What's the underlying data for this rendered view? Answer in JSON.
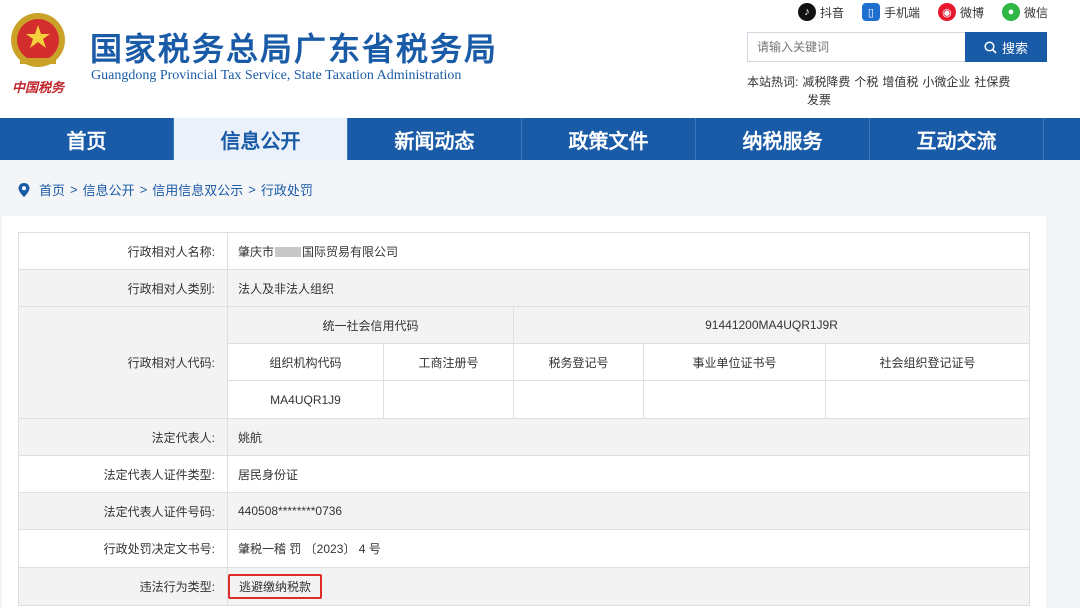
{
  "header": {
    "title_cn": "国家税务总局广东省税务局",
    "title_en": "Guangdong Provincial Tax Service, State Taxation Administration",
    "social": [
      {
        "label": "抖音",
        "icon": "douyin-icon"
      },
      {
        "label": "手机端",
        "icon": "mobile-icon"
      },
      {
        "label": "微博",
        "icon": "weibo-icon"
      },
      {
        "label": "微信",
        "icon": "wechat-icon"
      }
    ],
    "search": {
      "placeholder": "请输入关键词",
      "button_label": "搜索"
    },
    "hot": {
      "label": "本站热词:",
      "words": [
        "减税降费",
        "个税",
        "增值税",
        "小微企业",
        "社保费",
        "发票"
      ]
    }
  },
  "nav": {
    "items": [
      "首页",
      "信息公开",
      "新闻动态",
      "政策文件",
      "纳税服务",
      "互动交流"
    ],
    "active": "信息公开"
  },
  "breadcrumb": [
    "首页",
    "信息公开",
    "信用信息双公示",
    "行政处罚"
  ],
  "record": {
    "name_label": "行政相对人名称:",
    "name_prefix": "肇庆市",
    "name_suffix": "国际贸易有限公司",
    "category_label": "行政相对人类别:",
    "category_value": "法人及非法人组织",
    "code_label": "行政相对人代码:",
    "uscc_label": "统一社会信用代码",
    "uscc_value": "91441200MA4UQR1J9R",
    "code_headers": [
      "组织机构代码",
      "工商注册号",
      "税务登记号",
      "事业单位证书号",
      "社会组织登记证号"
    ],
    "code_values": [
      "MA4UQR1J9",
      "",
      "",
      "",
      ""
    ],
    "legal_rep_label": "法定代表人:",
    "legal_rep_value": "姚航",
    "id_type_label": "法定代表人证件类型:",
    "id_type_value": "居民身份证",
    "id_number_label": "法定代表人证件号码:",
    "id_number_value": "440508********0736",
    "decision_no_label": "行政处罚决定文书号:",
    "decision_no_value": "肇税一稽 罚 〔2023〕 4 号",
    "violation_label": "违法行为类型:",
    "violation_value": "逃避缴纳税款"
  },
  "colors": {
    "brand_blue": "#1a5ba8",
    "highlight_red": "#e02b2b"
  }
}
